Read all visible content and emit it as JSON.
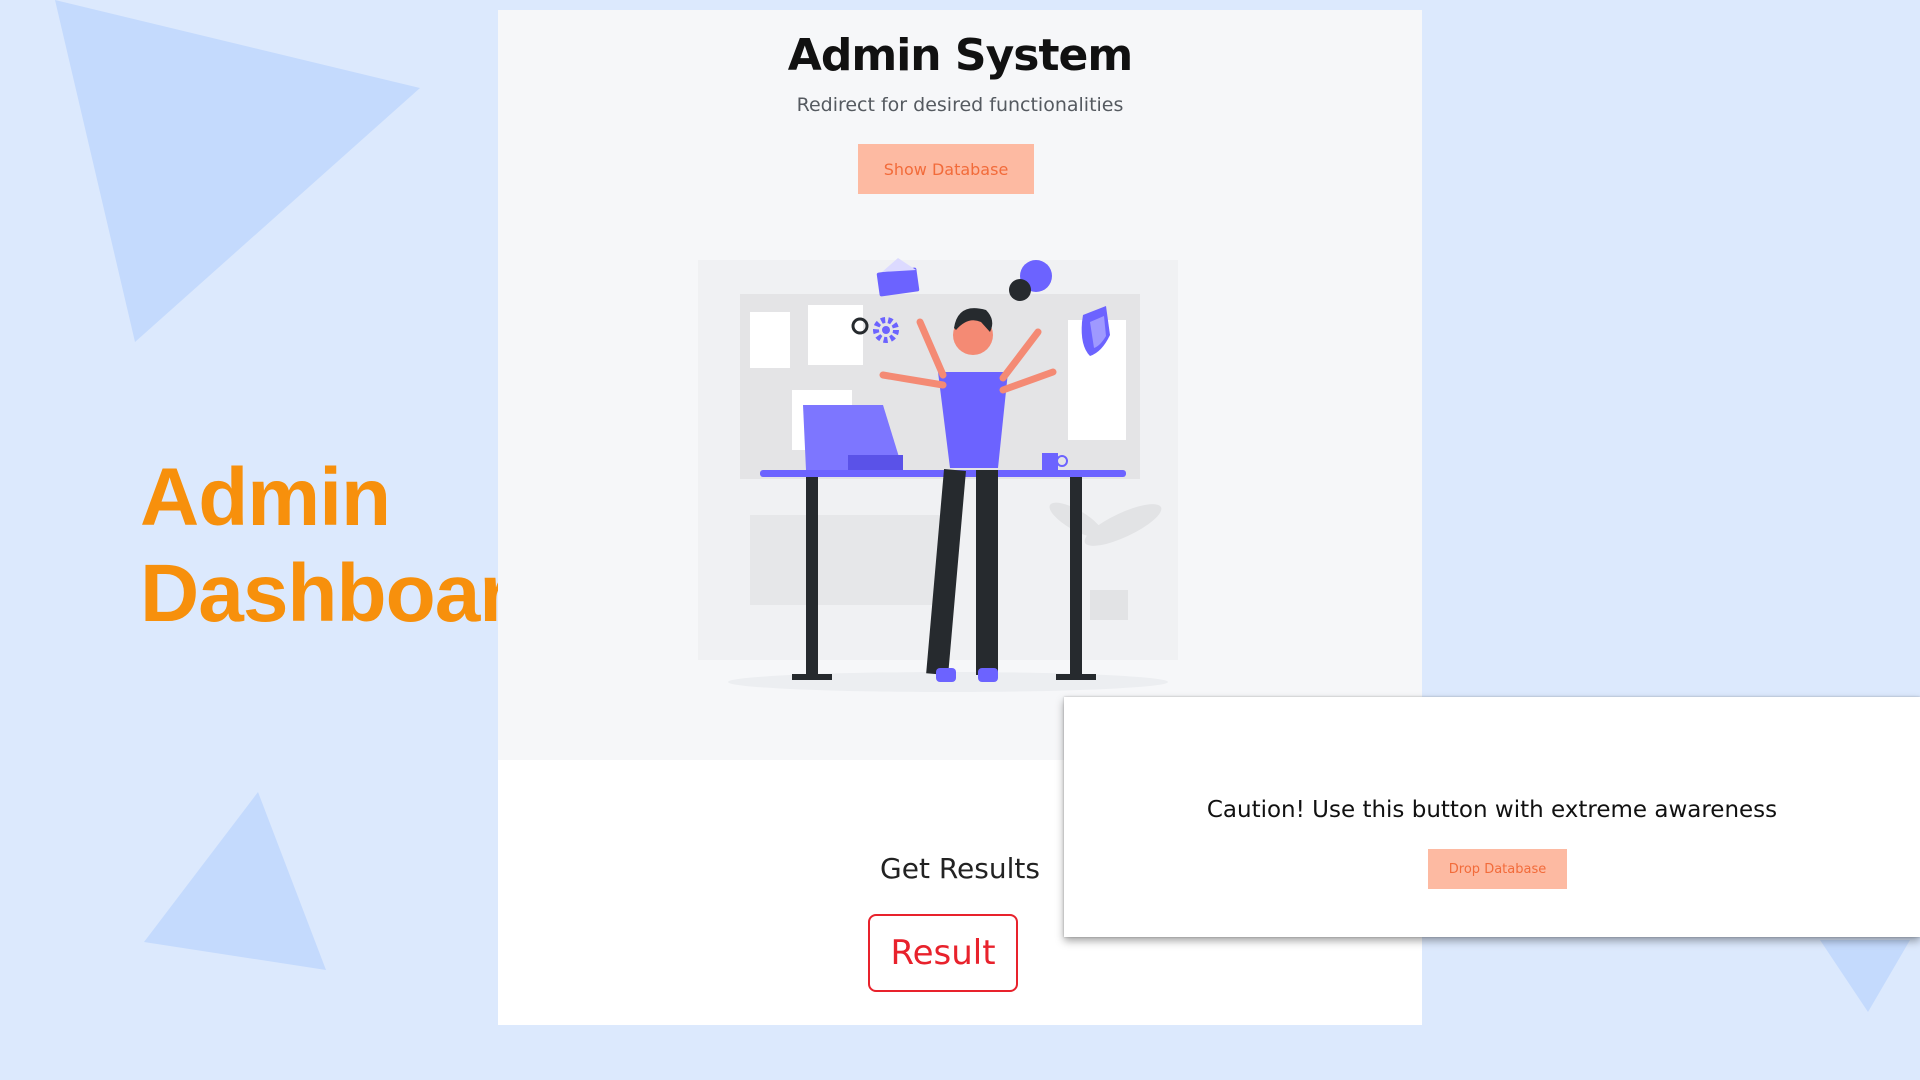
{
  "hero": {
    "line1": "Admin",
    "line2": "Dashboard"
  },
  "panel": {
    "title": "Admin System",
    "subtitle": "Redirect for desired functionalities",
    "show_button": "Show Database",
    "results_title": "Get Results",
    "result_button": "Result"
  },
  "modal": {
    "caution_text": "Caution! Use this button with extreme awareness",
    "drop_button": "Drop Database"
  },
  "colors": {
    "background": "#dce9fd",
    "accent_orange": "#f7900c",
    "button_peach": "#fdbaa2",
    "danger_red": "#e8222c",
    "illustration_purple": "#6c63ff"
  },
  "icons": [
    "envelope-icon",
    "gear-icon",
    "chat-bubble-icon",
    "shield-icon",
    "laptop-icon",
    "mug-icon",
    "plant-icon"
  ]
}
